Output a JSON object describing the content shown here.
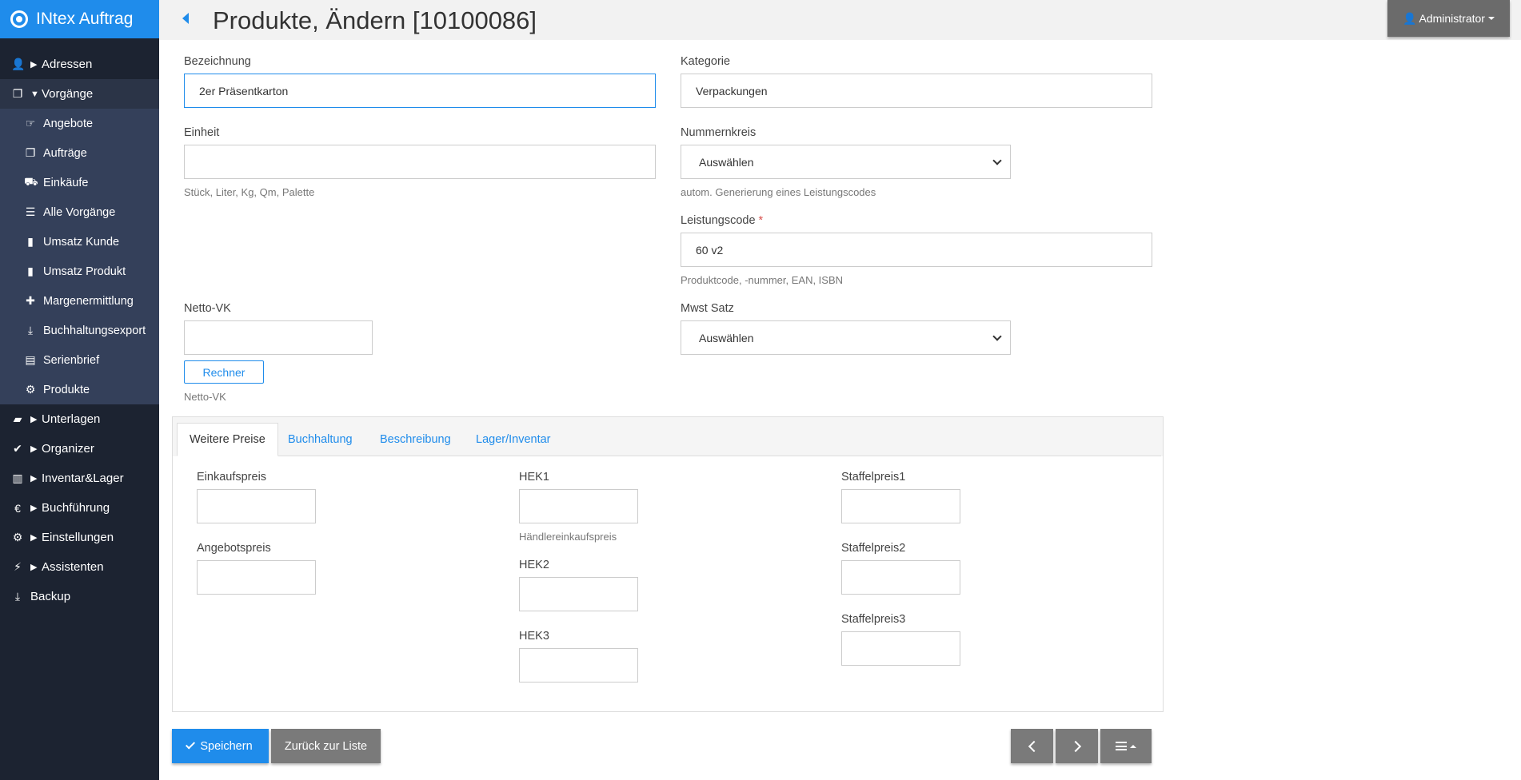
{
  "app": {
    "name": "INtex Auftrag"
  },
  "header": {
    "title": "Produkte, Ändern [10100086]",
    "user": "Administrator"
  },
  "sidebar": {
    "items": [
      {
        "label": "Adressen"
      },
      {
        "label": "Vorgänge"
      },
      {
        "label": "Unterlagen"
      },
      {
        "label": "Organizer"
      },
      {
        "label": "Inventar&Lager"
      },
      {
        "label": "Buchführung"
      },
      {
        "label": "Einstellungen"
      },
      {
        "label": "Assistenten"
      },
      {
        "label": "Backup"
      }
    ],
    "subitems": [
      {
        "label": "Angebote"
      },
      {
        "label": "Aufträge"
      },
      {
        "label": "Einkäufe"
      },
      {
        "label": "Alle Vorgänge"
      },
      {
        "label": "Umsatz Kunde"
      },
      {
        "label": "Umsatz Produkt"
      },
      {
        "label": "Margenermittlung"
      },
      {
        "label": "Buchhaltungsexport"
      },
      {
        "label": "Serienbrief"
      },
      {
        "label": "Produkte"
      }
    ]
  },
  "form": {
    "bezeichnung": {
      "label": "Bezeichnung",
      "value": "2er Präsentkarton"
    },
    "kategorie": {
      "label": "Kategorie",
      "value": "Verpackungen"
    },
    "einheit": {
      "label": "Einheit",
      "value": "",
      "help": "Stück, Liter, Kg, Qm, Palette"
    },
    "nummernkreis": {
      "label": "Nummernkreis",
      "value": "Auswählen",
      "help": "autom. Generierung eines Leistungscodes"
    },
    "leistungscode": {
      "label": "Leistungscode",
      "required": "*",
      "value": "60 v2",
      "help": "Produktcode, -nummer, EAN, ISBN"
    },
    "netto_vk": {
      "label": "Netto-VK",
      "value": "",
      "button": "Rechner",
      "help": "Netto-VK"
    },
    "mwst": {
      "label": "Mwst Satz",
      "value": "Auswählen"
    }
  },
  "tabs": [
    {
      "label": "Weitere Preise"
    },
    {
      "label": "Buchhaltung"
    },
    {
      "label": "Beschreibung"
    },
    {
      "label": "Lager/Inventar"
    }
  ],
  "prices": {
    "einkaufspreis": {
      "label": "Einkaufspreis",
      "value": ""
    },
    "angebotspreis": {
      "label": "Angebotspreis",
      "value": ""
    },
    "hek1": {
      "label": "HEK1",
      "value": "",
      "help": "Händlereinkaufspreis"
    },
    "hek2": {
      "label": "HEK2",
      "value": ""
    },
    "hek3": {
      "label": "HEK3",
      "value": ""
    },
    "staffel1": {
      "label": "Staffelpreis1",
      "value": ""
    },
    "staffel2": {
      "label": "Staffelpreis2",
      "value": ""
    },
    "staffel3": {
      "label": "Staffelpreis3",
      "value": ""
    }
  },
  "actions": {
    "save": "Speichern",
    "back": "Zurück zur Liste"
  }
}
